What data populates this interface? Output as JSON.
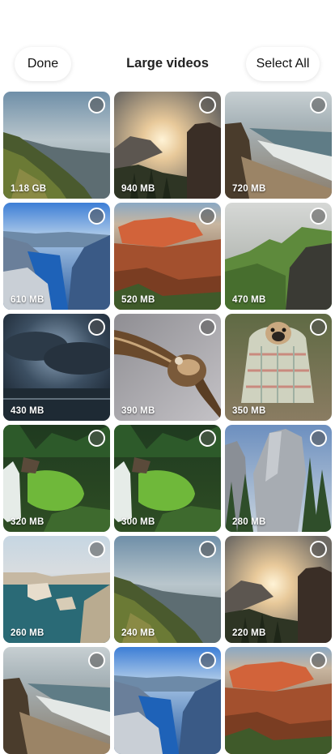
{
  "header": {
    "done_label": "Done",
    "title": "Large videos",
    "select_all_label": "Select All"
  },
  "videos": [
    {
      "size": "1.18 GB",
      "scene": "coast-cliffs"
    },
    {
      "size": "940 MB",
      "scene": "sunset-mountains"
    },
    {
      "size": "720 MB",
      "scene": "rocky-beach"
    },
    {
      "size": "610 MB",
      "scene": "fjord"
    },
    {
      "size": "520 MB",
      "scene": "red-cliffs"
    },
    {
      "size": "470 MB",
      "scene": "green-mountains"
    },
    {
      "size": "430 MB",
      "scene": "storm-clouds"
    },
    {
      "size": "390 MB",
      "scene": "vulture"
    },
    {
      "size": "350 MB",
      "scene": "pug-in-blanket"
    },
    {
      "size": "320 MB",
      "scene": "waterfall"
    },
    {
      "size": "300 MB",
      "scene": "waterfall"
    },
    {
      "size": "280 MB",
      "scene": "granite-peaks"
    },
    {
      "size": "260 MB",
      "scene": "sea-arches"
    },
    {
      "size": "240 MB",
      "scene": "coast-cliffs"
    },
    {
      "size": "220 MB",
      "scene": "sunset-mountains"
    },
    {
      "size": "",
      "scene": "rocky-beach"
    },
    {
      "size": "",
      "scene": "fjord"
    },
    {
      "size": "",
      "scene": "red-cliffs"
    }
  ]
}
